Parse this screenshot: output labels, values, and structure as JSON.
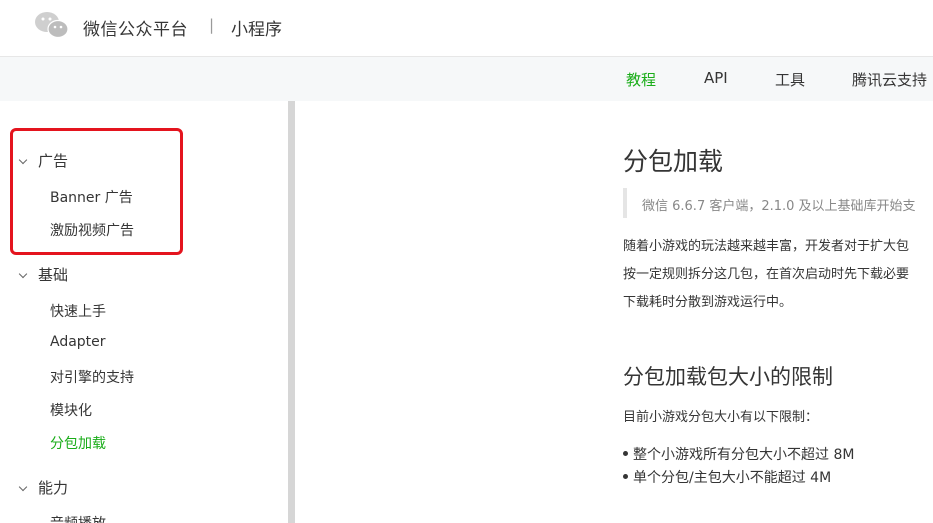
{
  "header": {
    "brand": "微信公众平台",
    "separator": "|",
    "sub": "小程序"
  },
  "nav": {
    "items": [
      {
        "label": "教程",
        "active": true
      },
      {
        "label": "API"
      },
      {
        "label": "工具"
      },
      {
        "label": "腾讯云支持"
      }
    ]
  },
  "sidebar": {
    "groups": [
      {
        "label": "广告",
        "items": [
          {
            "label": "Banner 广告"
          },
          {
            "label": "激励视频广告"
          }
        ]
      },
      {
        "label": "基础",
        "items": [
          {
            "label": "快速上手"
          },
          {
            "label": "Adapter"
          },
          {
            "label": "对引擎的支持"
          },
          {
            "label": "模块化"
          },
          {
            "label": "分包加载",
            "active": true
          }
        ]
      },
      {
        "label": "能力",
        "items": [
          {
            "label": "音频播放"
          }
        ]
      }
    ]
  },
  "content": {
    "title": "分包加载",
    "note": "微信 6.6.7 客户端，2.1.0 及以上基础库开始支",
    "intro_lines": [
      "随着小游戏的玩法越来越丰富，开发者对于扩大包",
      "按一定规则拆分这几包，在首次启动时先下载必要",
      "下载耗时分散到游戏运行中。"
    ],
    "section_title": "分包加载包大小的限制",
    "section_intro": "目前小游戏分包大小有以下限制：",
    "bullets": [
      "整个小游戏所有分包大小不超过 8M",
      "单个分包/主包大小不能超过 4M"
    ]
  },
  "colors": {
    "accent_green": "#1aad19",
    "highlight_red": "#e4141e"
  }
}
